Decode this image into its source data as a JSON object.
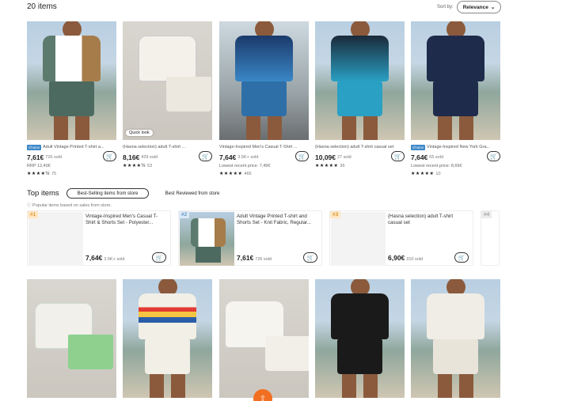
{
  "header": {
    "count": "20 items",
    "sort_label": "Sort by:",
    "sort_value": "Relevance",
    "sort_icon": "chevron-down-icon"
  },
  "products": [
    {
      "badge": "Choice",
      "title": "Adult Vintage Printed T-shirt a...",
      "price": "7,61€",
      "sold": "726 sold",
      "sub": "RRP 12,40€",
      "stars": "★★★★½",
      "reviews": "75",
      "shirt_color": "#5d7a6e",
      "shorts_color": "#4c6a60",
      "bg": "beach"
    },
    {
      "badge": "",
      "title": "(Hasna selection) adult T-shirt ...",
      "price": "8,16€",
      "sold": "429 sold",
      "sub": "",
      "stars": "★★★★½",
      "reviews": "53",
      "shirt_color": "#f4f1ea",
      "shorts_color": "#ece8df",
      "bg": "wall",
      "quick_look": "Quick look"
    },
    {
      "badge": "",
      "title": "Vintage-Inspired Men's Casual T-Shirt ...",
      "price": "7,64€",
      "sold": "3.5K+ sold",
      "sub": "Lowest recent price: 7,49€",
      "stars": "★★★★★",
      "reviews": "465",
      "shirt_color": "#3a87c7",
      "shorts_color": "#2e6fa8",
      "bg": "street"
    },
    {
      "badge": "",
      "title": "(Hasna selection) adult T-shirt casual set",
      "price": "10,09€",
      "sold": "27 sold",
      "sub": "",
      "stars": "★★★★★",
      "reviews": "36",
      "shirt_color": "#2aa0c4",
      "shorts_color": "#2aa0c4",
      "bg": "beach"
    },
    {
      "badge": "Choice",
      "title": "Vintage-Inspired New York Gra...",
      "price": "7,64€",
      "sold": "65 sold",
      "sub": "Lowest recent price: 8,69€",
      "stars": "★★★★★",
      "reviews": "10",
      "shirt_color": "#1f2b4a",
      "shorts_color": "#1f2b4a",
      "bg": "beach"
    }
  ],
  "top_items": {
    "title": "Top items",
    "tabs": [
      "Best-Selling items from store",
      "Best Reviewed from store"
    ],
    "note": "ⓘ Popular items based on sales from store.",
    "items": [
      {
        "rank": "#1",
        "title": "Vintage-Inspired Men's Casual T-Shirt & Shorts Set - Polyester...",
        "price": "7,64€",
        "sold": "3.5K+ sold"
      },
      {
        "rank": "#2",
        "title": "Adult Vintage Printed T-shirt and Shorts Set - Knit Fabric, Regular...",
        "price": "7,61€",
        "sold": "726 sold"
      },
      {
        "rank": "#3",
        "title": "(Hasna selection) adult T-shirt casual set",
        "price": "6,90€",
        "sold": "310 sold"
      },
      {
        "rank": "#4",
        "title": "",
        "price": "",
        "sold": ""
      }
    ]
  },
  "row2": [
    {
      "shirt_color": "#f2f0ea",
      "shorts_color": "#8fd08f",
      "bg": "wall"
    },
    {
      "shirt_color": "#f2efe6",
      "shorts_color": "#f2efe6",
      "bg": "beach"
    },
    {
      "shirt_color": "#f6f4ef",
      "shorts_color": "#f2efe8",
      "bg": "wall"
    },
    {
      "shirt_color": "#1a1a1a",
      "shorts_color": "#1a1a1a",
      "bg": "beach"
    },
    {
      "shirt_color": "#f0ede6",
      "shorts_color": "#e9e4da",
      "bg": "beach"
    }
  ],
  "icons": {
    "cart": "cart-icon"
  }
}
